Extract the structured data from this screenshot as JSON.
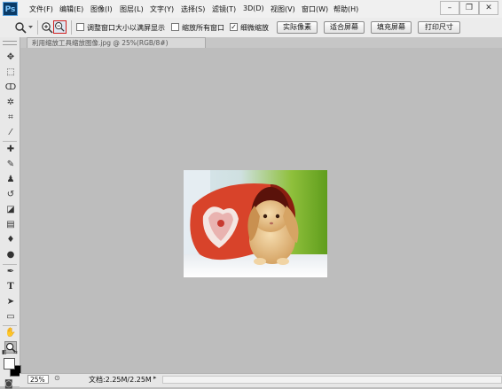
{
  "app": {
    "logo_text": "Ps"
  },
  "menu": [
    "文件(F)",
    "编辑(E)",
    "图像(I)",
    "图层(L)",
    "文字(Y)",
    "选择(S)",
    "滤镜(T)",
    "3D(D)",
    "视图(V)",
    "窗口(W)",
    "帮助(H)"
  ],
  "window_controls": {
    "minimize": "–",
    "restore": "❐",
    "close": "✕"
  },
  "options": {
    "resize_windows_label": "调整窗口大小以满屏显示",
    "resize_windows_checked": false,
    "zoom_all_label": "缩放所有窗口",
    "zoom_all_checked": false,
    "scrubby_zoom_label": "细微缩放",
    "scrubby_zoom_checked": true,
    "actual_pixels": "实际像素",
    "fit_screen": "适合屏幕",
    "fill_screen": "填充屏幕",
    "print_size": "打印尺寸"
  },
  "document": {
    "tab_title": "利用缩放工具缩放图像.jpg @ 25%(RGB/8#)"
  },
  "status": {
    "zoom": "25%",
    "doc_size": "文档:2.25M/2.25M"
  },
  "icons": {
    "move": "move-icon",
    "marquee": "rect-marquee-icon",
    "lasso": "lasso-icon",
    "quick_select": "quick-select-icon",
    "crop": "crop-icon",
    "eyedropper": "eyedropper-icon",
    "healing": "healing-brush-icon",
    "brush": "brush-icon",
    "stamp": "clone-stamp-icon",
    "history_brush": "history-brush-icon",
    "eraser": "eraser-icon",
    "gradient": "gradient-icon",
    "blur": "blur-icon",
    "dodge": "dodge-icon",
    "pen": "pen-icon",
    "type": "type-icon",
    "path_select": "path-select-icon",
    "shape": "rectangle-shape-icon",
    "hand": "hand-icon",
    "zoom": "zoom-icon"
  },
  "colors": {
    "logo_bg": "#0a3a66",
    "canvas_bg": "#bdbdbd",
    "active_tool_border": "#d02020"
  }
}
